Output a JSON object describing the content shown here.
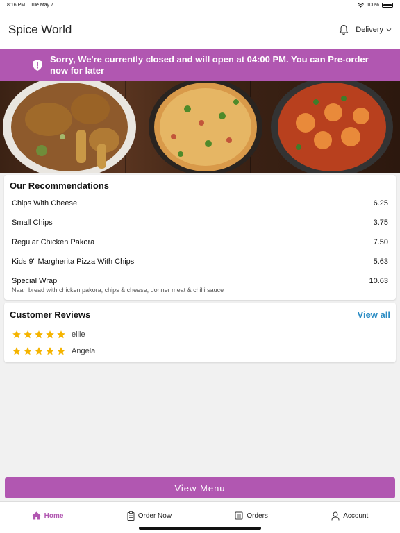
{
  "status_bar": {
    "time": "8:16 PM",
    "date": "Tue May 7",
    "battery": "100%"
  },
  "header": {
    "title": "Spice World",
    "delivery_label": "Delivery"
  },
  "banner": {
    "text": "Sorry, We're currently closed and will open at 04:00 PM. You can Pre-order now for later"
  },
  "recommendations": {
    "title": "Our Recommendations",
    "items": [
      {
        "name": "Chips With Cheese",
        "price": "6.25",
        "description": ""
      },
      {
        "name": "Small Chips",
        "price": "3.75",
        "description": ""
      },
      {
        "name": "Regular Chicken Pakora",
        "price": "7.50",
        "description": ""
      },
      {
        "name": "Kids 9\" Margherita Pizza With Chips",
        "price": "5.63",
        "description": ""
      },
      {
        "name": "Special Wrap",
        "price": "10.63",
        "description": "Naan bread with chicken pakora, chips & cheese, donner meat & chilli sauce"
      }
    ]
  },
  "reviews": {
    "title": "Customer Reviews",
    "view_all": "View all",
    "items": [
      {
        "name": "ellie",
        "rating": 5
      },
      {
        "name": "Angela",
        "rating": 5
      }
    ]
  },
  "view_menu_label": "View Menu",
  "tabs": [
    {
      "label": "Home",
      "icon": "home-icon",
      "active": true
    },
    {
      "label": "Order Now",
      "icon": "order-icon",
      "active": false
    },
    {
      "label": "Orders",
      "icon": "orders-icon",
      "active": false
    },
    {
      "label": "Account",
      "icon": "account-icon",
      "active": false
    }
  ],
  "colors": {
    "brand": "#b157b1",
    "link": "#2a8cc4",
    "star": "#f5b400"
  }
}
